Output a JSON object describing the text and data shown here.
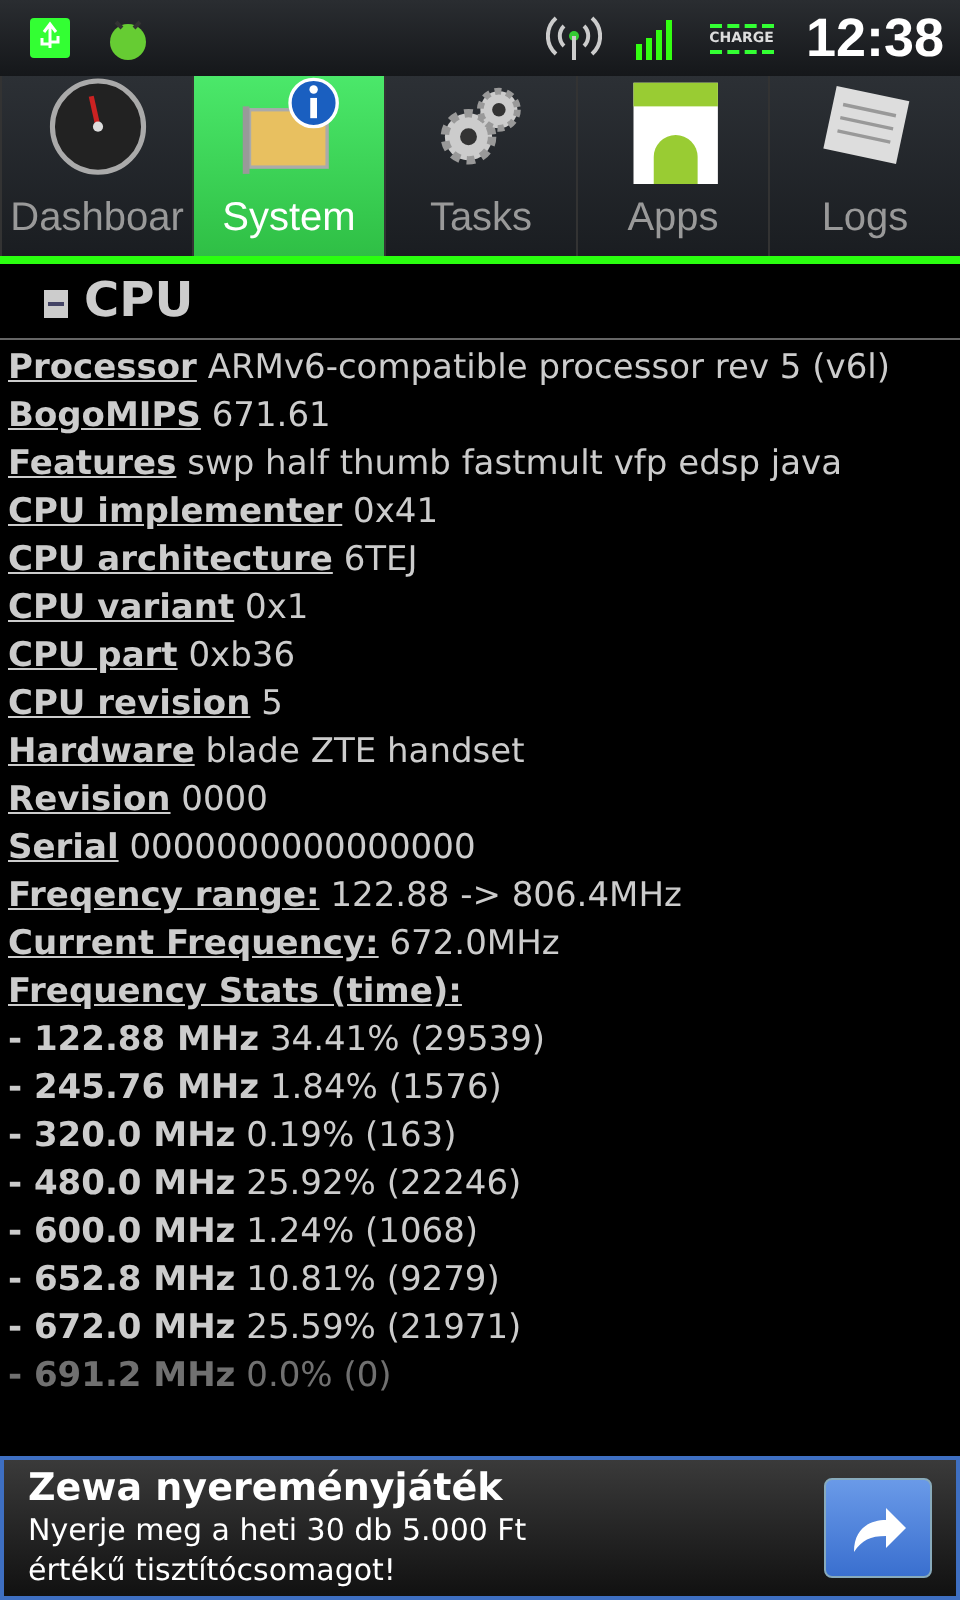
{
  "status_bar": {
    "battery_label": "CHARGE",
    "time": "12:38"
  },
  "tabs": [
    {
      "label": "Dashboar",
      "selected": false
    },
    {
      "label": "System",
      "selected": true
    },
    {
      "label": "Tasks",
      "selected": false
    },
    {
      "label": "Apps",
      "selected": false
    },
    {
      "label": "Logs",
      "selected": false
    }
  ],
  "section": {
    "title": "CPU",
    "expanded": true
  },
  "rows": [
    {
      "kind": "field",
      "label": "Processor",
      "value": "ARMv6-compatible processor rev 5 (v6l)"
    },
    {
      "kind": "field",
      "label": "BogoMIPS",
      "value": "671.61"
    },
    {
      "kind": "field",
      "label": "Features",
      "value": "swp half thumb fastmult vfp edsp java"
    },
    {
      "kind": "field",
      "label": "CPU implementer",
      "value": "0x41"
    },
    {
      "kind": "field",
      "label": "CPU architecture",
      "value": "6TEJ"
    },
    {
      "kind": "field",
      "label": "CPU variant",
      "value": "0x1"
    },
    {
      "kind": "field",
      "label": "CPU part",
      "value": "0xb36"
    },
    {
      "kind": "field",
      "label": "CPU revision",
      "value": "5"
    },
    {
      "kind": "field",
      "label": "Hardware",
      "value": "blade ZTE handset"
    },
    {
      "kind": "field",
      "label": "Revision",
      "value": "0000"
    },
    {
      "kind": "field",
      "label": "Serial",
      "value": "0000000000000000"
    },
    {
      "kind": "field",
      "label": "Freqency range:",
      "value": "122.88 -> 806.4MHz"
    },
    {
      "kind": "field",
      "label": "Current Frequency:",
      "value": "672.0MHz"
    },
    {
      "kind": "field",
      "label": "Frequency Stats (time):"
    },
    {
      "kind": "stat",
      "label": "- 122.88 MHz",
      "value": "34.41% (29539)"
    },
    {
      "kind": "stat",
      "label": "- 245.76 MHz",
      "value": "1.84% (1576)"
    },
    {
      "kind": "stat",
      "label": "- 320.0 MHz",
      "value": "0.19% (163)"
    },
    {
      "kind": "stat",
      "label": "- 480.0 MHz",
      "value": "25.92% (22246)"
    },
    {
      "kind": "stat",
      "label": "- 600.0 MHz",
      "value": "1.24% (1068)"
    },
    {
      "kind": "stat",
      "label": "- 652.8 MHz",
      "value": "10.81% (9279)"
    },
    {
      "kind": "stat",
      "label": "- 672.0 MHz",
      "value": "25.59% (21971)"
    },
    {
      "kind": "stat",
      "label": "- 691.2 MHz",
      "value": "0.0% (0)"
    }
  ],
  "ad": {
    "title": "Zewa nyereményjáték",
    "text": "Nyerje meg a heti 30 db 5.000 Ft értékű tisztítócsomagot!"
  }
}
